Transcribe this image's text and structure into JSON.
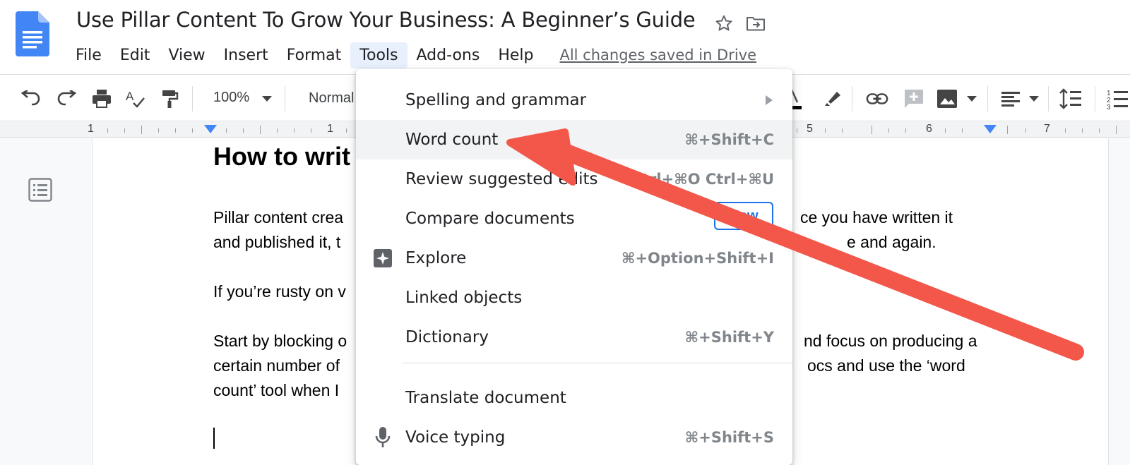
{
  "document": {
    "title": "Use Pillar Content To Grow Your Business: A Beginner’s Guide",
    "saved_status": "All changes saved in Drive"
  },
  "menubar": {
    "items": [
      "File",
      "Edit",
      "View",
      "Insert",
      "Format",
      "Tools",
      "Add-ons",
      "Help"
    ],
    "active": "Tools"
  },
  "toolbar": {
    "zoom": "100%",
    "style": "Normal"
  },
  "ruler": {
    "left_labels": [
      "1",
      "1"
    ],
    "right_labels": [
      "5",
      "6",
      "7"
    ]
  },
  "body": {
    "heading": "How to writ",
    "lines": [
      "Pillar content crea",
      "and published it, t",
      "If you’re rusty on v",
      "Start by blocking o",
      "certain number of",
      "count’ tool when I"
    ],
    "right_lines": [
      "ce you have written it",
      "e and again.",
      "nd focus on producing a",
      "ocs and use the ‘word"
    ]
  },
  "tools_menu": {
    "items": [
      {
        "label": "Spelling and grammar",
        "shortcut": "",
        "has_submenu": true,
        "icon": ""
      },
      {
        "label": "Word count",
        "shortcut": "⌘+Shift+C",
        "has_submenu": false,
        "icon": "",
        "highlighted": true
      },
      {
        "label": "Review suggested edits",
        "shortcut": "Ctrl+⌘O Ctrl+⌘U",
        "has_submenu": false,
        "icon": ""
      },
      {
        "label": "Compare documents",
        "shortcut": "",
        "has_submenu": false,
        "icon": "",
        "badge": "New"
      },
      {
        "label": "Explore",
        "shortcut": "⌘+Option+Shift+I",
        "has_submenu": false,
        "icon": "explore-icon"
      },
      {
        "label": "Linked objects",
        "shortcut": "",
        "has_submenu": false,
        "icon": ""
      },
      {
        "label": "Dictionary",
        "shortcut": "⌘+Shift+Y",
        "has_submenu": false,
        "icon": ""
      },
      {
        "label": "Translate document",
        "shortcut": "",
        "has_submenu": false,
        "icon": ""
      },
      {
        "label": "Voice typing",
        "shortcut": "⌘+Shift+S",
        "has_submenu": false,
        "icon": "microphone-icon"
      }
    ]
  },
  "colors": {
    "accent": "#1a73e8",
    "annotation_arrow": "#f2574a",
    "menu_hover": "#f1f3f4",
    "active_menu": "#e8f0fe"
  }
}
